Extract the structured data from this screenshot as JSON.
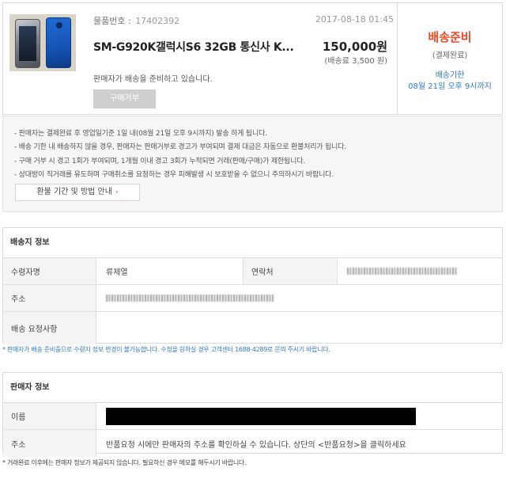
{
  "order": {
    "number_label": "물품번호 :",
    "number": "17402392",
    "date": "2017-08-18 01:45",
    "product_title": "SM-G920K갤럭시S6 32GB 통신사 K...",
    "price": "150,000원",
    "shipping_fee": "(배송료 3,500 원)",
    "seller_message": "판매자가 배송을 준비하고 있습니다.",
    "reject_button": "구매거부"
  },
  "status": {
    "main": "배송준비",
    "sub": "(결제완료)",
    "deadline_label": "배송기한",
    "deadline_value": "08월 21일 오후 9시까지",
    "color_main": "#f04a24",
    "color_deadline": "#2e7bd6"
  },
  "notices": [
    "- 판매자는 결제완료 후 영업일기준 1일 내(08월 21일 오후 9시까지) 발송 하게 됩니다.",
    "- 배송 기한 내 배송하지 않을 경우, 판매자는 판매거부로 경고가 부여되며 결제 대금은 자동으로 환불처리가 됩니다.",
    "- 구매 거부 시 경고 1회가 부여되며, 1개월 이내 경고 3회가 누적되면 거래(판매/구매)가 제한됩니다.",
    "- 상대방이 직거래를 유도하며 구매취소를 요청하는 경우 피해발생 시 보호받을 수 없으니 주의하시기 바랍니다."
  ],
  "refund_button": "환불 기간 및 방법 안내",
  "refund_arrow": "›",
  "shipping_info": {
    "title": "배송지 정보",
    "receiver_label": "수령자명",
    "receiver_value": "류제열",
    "contact_label": "연락처",
    "address_label": "주소",
    "request_label": "배송 요청사항",
    "request_value": ""
  },
  "shipping_note": "* 판매자가 배송 준비중으로 수령지 정보 변경이 불가능합니다. 수정을 원하실 경우 고객센터 1688-4289로 문의 주시기 바랍니다.",
  "seller_info": {
    "title": "판매자 정보",
    "name_label": "이름",
    "address_label": "주소",
    "address_value": "반품요청 시에만 판매자의 주소를 확인하실 수 있습니다. 상단의 <반품요청>을 클릭하세요"
  },
  "footer_note": "* 거래완료 이후에는 판매자 정보가 제공되지 않습니다. 필요하신 경우 메모를 해두시기 바랍니다."
}
